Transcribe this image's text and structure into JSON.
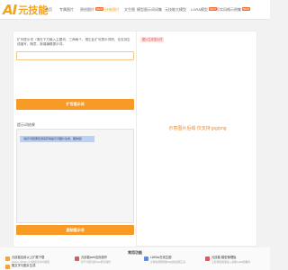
{
  "header": {
    "logo_mark": "AI",
    "logo_text": "元技能",
    "nav": [
      {
        "label": "首页",
        "active": false
      },
      {
        "label": "专属图片",
        "active": false
      },
      {
        "label": "原创图片",
        "active": false,
        "badge": "NEW"
      },
      {
        "label": "元技能图片",
        "active": true
      },
      {
        "label": "文生图",
        "active": false
      },
      {
        "label": "模型图示词词集",
        "active": false
      },
      {
        "label": "元技能大模型",
        "active": false
      },
      {
        "label": "LORA模型",
        "active": false,
        "badge": "NEW"
      },
      {
        "label": "写实风格示例集",
        "active": false,
        "badge": "NEW"
      }
    ]
  },
  "left_panel": {
    "tip": "扩写提示词（请在下方输入主题词，三两两个、想正此扩写提示词吧、也支持生成缩写、随意、新增编辑提示词。",
    "input_placeholder": "",
    "expand_button": "扩写提示词",
    "result_label": "提示词结果",
    "result_highlight": "（提示词结果区用来获得提示词图片生成、图体组）",
    "copy_button": "复制提示词"
  },
  "right_panel": {
    "tag": "图片生成提示词",
    "placeholder": "示意图片后缀 仅支持 jpg/png"
  },
  "common": {
    "title": "常用功能",
    "features": [
      {
        "icon": "chat-icon",
        "color": "#f0a53a",
        "name": "元技能应用以上扩展下载",
        "desc": "Flutter_SD3C_5.0蕾唐某中大模型"
      },
      {
        "icon": "image-icon",
        "color": "#e35656",
        "name": "元技能web应用操作",
        "desc": "基于大研究和web结行操作"
      },
      {
        "icon": "pen-icon",
        "color": "#5a8de0",
        "name": "LibShu在线生图",
        "desc": "全网免费即用的AI在线生图工具"
      },
      {
        "icon": "model-icon",
        "color": "#e35656",
        "name": "元技能-模型管理板",
        "desc": "上新特定模型接入多数LoRa的推荐"
      },
      {
        "icon": "text-icon",
        "color": "#f0a53a",
        "name": "融文字与图片生成",
        "desc": "快速文字模型在线发及生成"
      }
    ]
  }
}
